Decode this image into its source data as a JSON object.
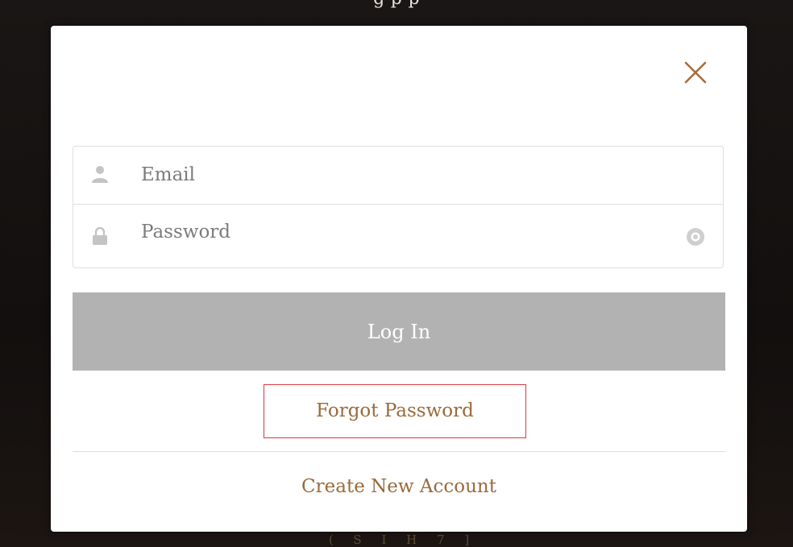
{
  "background": {
    "top_text": "g                                   p               p",
    "bottom_logo": "( S I H 7 ]"
  },
  "modal": {
    "close_icon": "close-x-icon",
    "email": {
      "icon": "user-icon",
      "value": "",
      "placeholder": "Email"
    },
    "password": {
      "icon": "lock-icon",
      "value": "",
      "placeholder": "Password",
      "toggle_icon": "eye-icon"
    },
    "login_label": "Log In",
    "forgot_label": "Forgot Password",
    "create_label": "Create New Account"
  },
  "colors": {
    "accent": "#a96b3a",
    "link": "#9a6a3c",
    "button_disabled": "#b2b2b2",
    "highlight_box": "#d9383f"
  }
}
